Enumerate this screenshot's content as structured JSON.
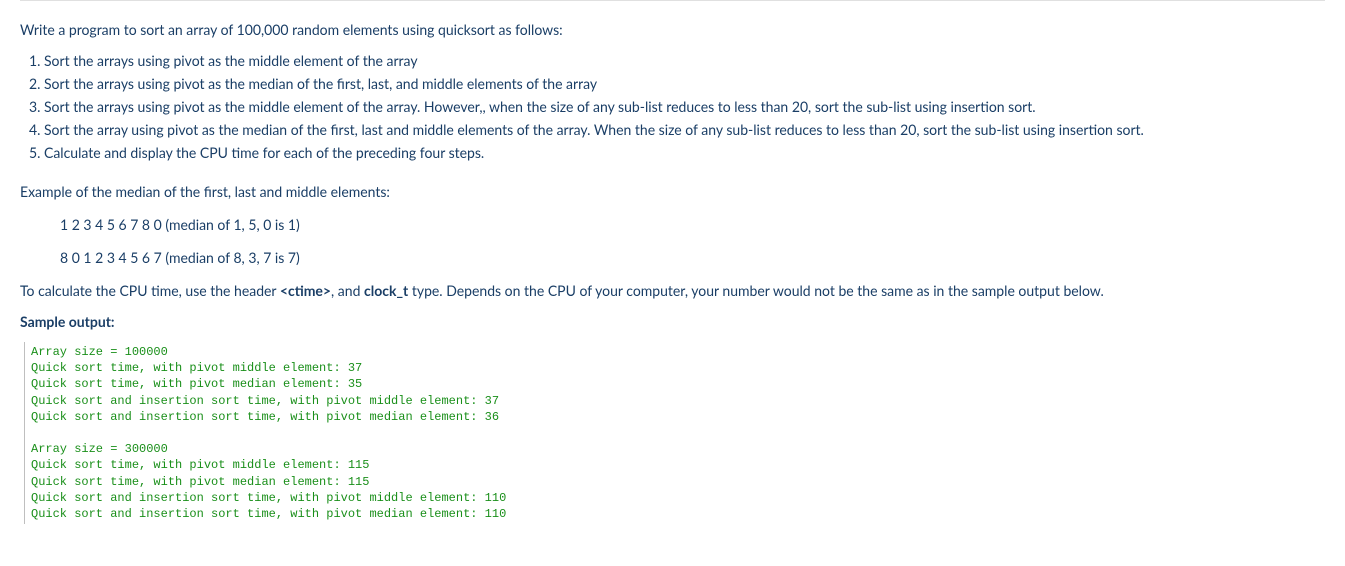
{
  "intro": "Write a program to sort an array of 100,000 random elements using quicksort as follows:",
  "steps": [
    "Sort the arrays using pivot as the middle element of the array",
    "Sort the arrays using pivot as the median of the first, last, and middle elements of the array",
    "Sort the arrays using pivot as the middle element of the array. However,, when the size of any sub-list reduces to less than 20, sort the sub-list using insertion sort.",
    "Sort the array using pivot as the median of the first, last and middle elements of the array. When the size of any sub-list reduces to less than 20, sort the sub-list using insertion sort.",
    "Calculate and display the CPU time for each of the preceding four steps."
  ],
  "example_heading": "Example of the median of the first, last and middle elements:",
  "example_lines": [
    "1 2 3 4 5 6 7 8 0 (median of 1, 5, 0 is 1)",
    "8 0 1 2 3 4 5 6 7 (median of 8, 3, 7 is 7)"
  ],
  "calc_prefix": "To calculate the CPU time, use the header ",
  "calc_ctime": "<ctime>",
  "calc_mid": ", and ",
  "calc_clockt": "clock_t",
  "calc_suffix": " type.   Depends on the CPU of your computer, your number would not be the same as in the sample output below.",
  "sample_label": "Sample output:",
  "sample_output": "Array size = 100000\nQuick sort time, with pivot middle element: 37\nQuick sort time, with pivot median element: 35\nQuick sort and insertion sort time, with pivot middle element: 37\nQuick sort and insertion sort time, with pivot median element: 36\n\nArray size = 300000\nQuick sort time, with pivot middle element: 115\nQuick sort time, with pivot median element: 115\nQuick sort and insertion sort time, with pivot middle element: 110\nQuick sort and insertion sort time, with pivot median element: 110"
}
